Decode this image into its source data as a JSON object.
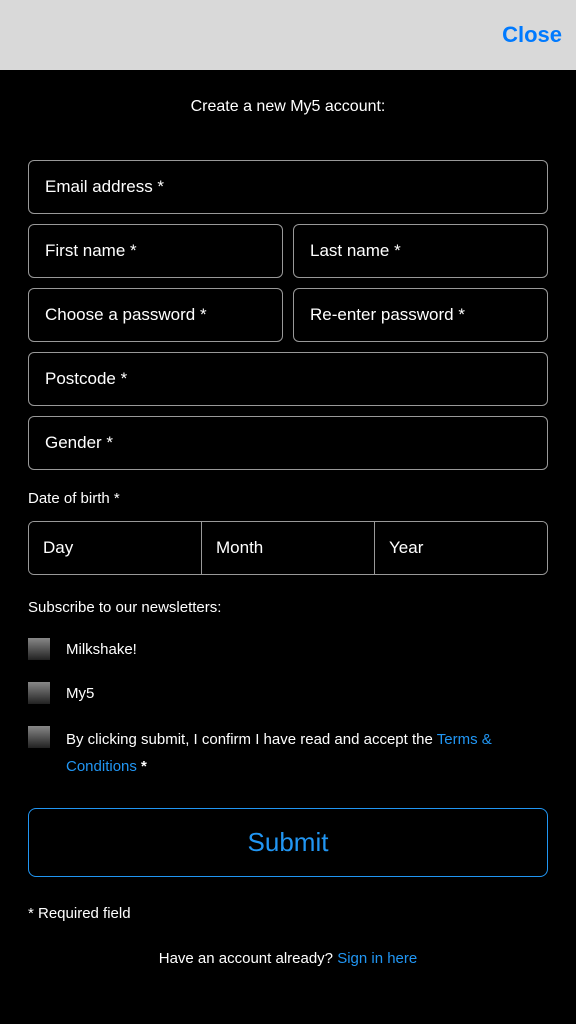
{
  "header": {
    "close": "Close"
  },
  "title": "Create a new My5 account:",
  "fields": {
    "email": "Email address *",
    "firstName": "First name *",
    "lastName": "Last name *",
    "password": "Choose a password *",
    "passwordConfirm": "Re-enter password *",
    "postcode": "Postcode *",
    "gender": "Gender *"
  },
  "dob": {
    "label": "Date of birth *",
    "day": "Day",
    "month": "Month",
    "year": "Year"
  },
  "newsletters": {
    "label": "Subscribe to our newsletters:",
    "items": [
      "Milkshake!",
      "My5"
    ]
  },
  "terms": {
    "prefix": "By clicking submit, I confirm I have read and accept the ",
    "link": "Terms & Conditions",
    "asterisk": " *"
  },
  "submit": "Submit",
  "requiredNote": "* Required field",
  "signin": {
    "prefix": "Have an account already? ",
    "link": "Sign in here"
  }
}
